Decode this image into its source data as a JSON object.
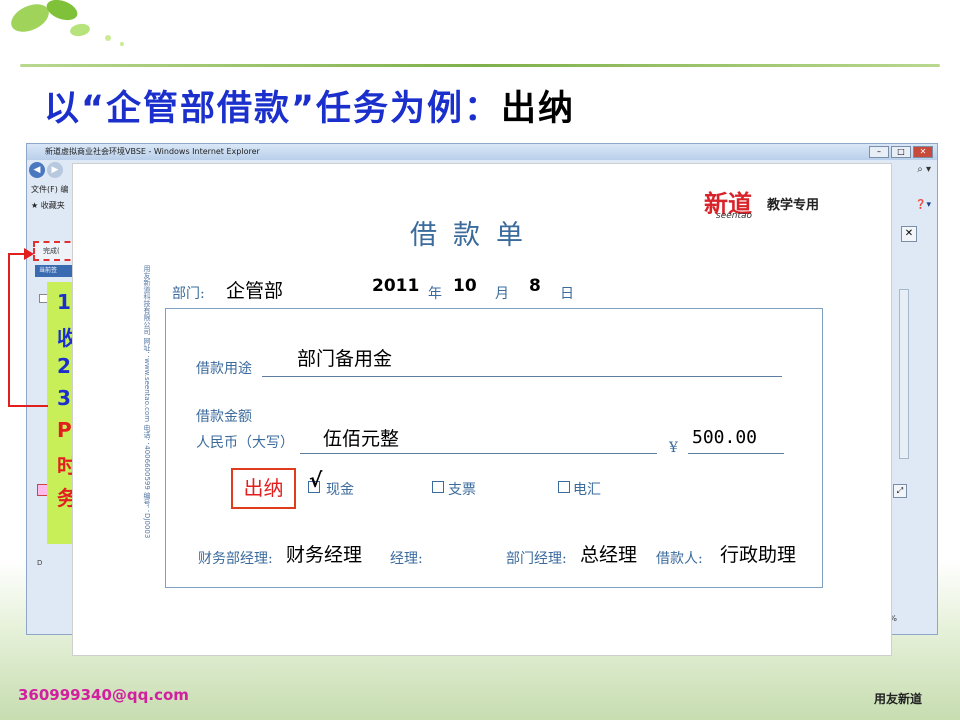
{
  "slide": {
    "title_prefix": "以“企管部借款”任务为例：",
    "title_highlight": "出纳",
    "footer_email": "360999340@qq.com",
    "footer_brand": "用友新道"
  },
  "browser": {
    "window_title": "新道虚拟商业社会环境VBSE - Windows Internet Explorer",
    "menu_file": "文件(F)",
    "menu_edit": "编",
    "favorites": "收藏夹",
    "tab_done": "完成(",
    "tab_current": "当前签",
    "zoom": "%",
    "left_d": "D"
  },
  "note_lines": [
    {
      "text": "1",
      "color": "blue"
    },
    {
      "text": "收",
      "color": "blue"
    },
    {
      "text": "2",
      "color": "blue"
    },
    {
      "text": "3",
      "color": "blue"
    },
    {
      "text": "P",
      "color": "red"
    },
    {
      "text": "时",
      "color": "red"
    },
    {
      "text": "务",
      "color": "red"
    }
  ],
  "form": {
    "title": "借款单",
    "logo_main": "新道",
    "logo_sub": "教学专用",
    "logo_en": "seentao",
    "side_text": "用友新道科技有限公司    网址：www.seentao.com    电话：4006600599    编号：DJ0003",
    "dept_label": "部门:",
    "dept_value": "企管部",
    "year_value": "2011",
    "year_label": "年",
    "month_value": "10",
    "month_label": "月",
    "day_value": "8",
    "day_label": "日",
    "purpose_label": "借款用途",
    "purpose_value": "部门备用金",
    "amount_label": "借款金额",
    "rmb_label": "人民币（大写）",
    "amount_text": "伍佰元整",
    "yen_symbol": "¥",
    "amount_number": "500.00",
    "cashier_label": "出纳",
    "checkmark": "√",
    "cash_label": "现金",
    "cheque_label": "支票",
    "wire_label": "电汇",
    "fin_manager_label": "财务部经理:",
    "fin_manager_value": "财务经理",
    "manager_label_suffix": "经理:",
    "dept_manager_label": "部门经理:",
    "dept_manager_value": "总经理",
    "borrower_label": "借款人:",
    "borrower_value": "行政助理"
  }
}
